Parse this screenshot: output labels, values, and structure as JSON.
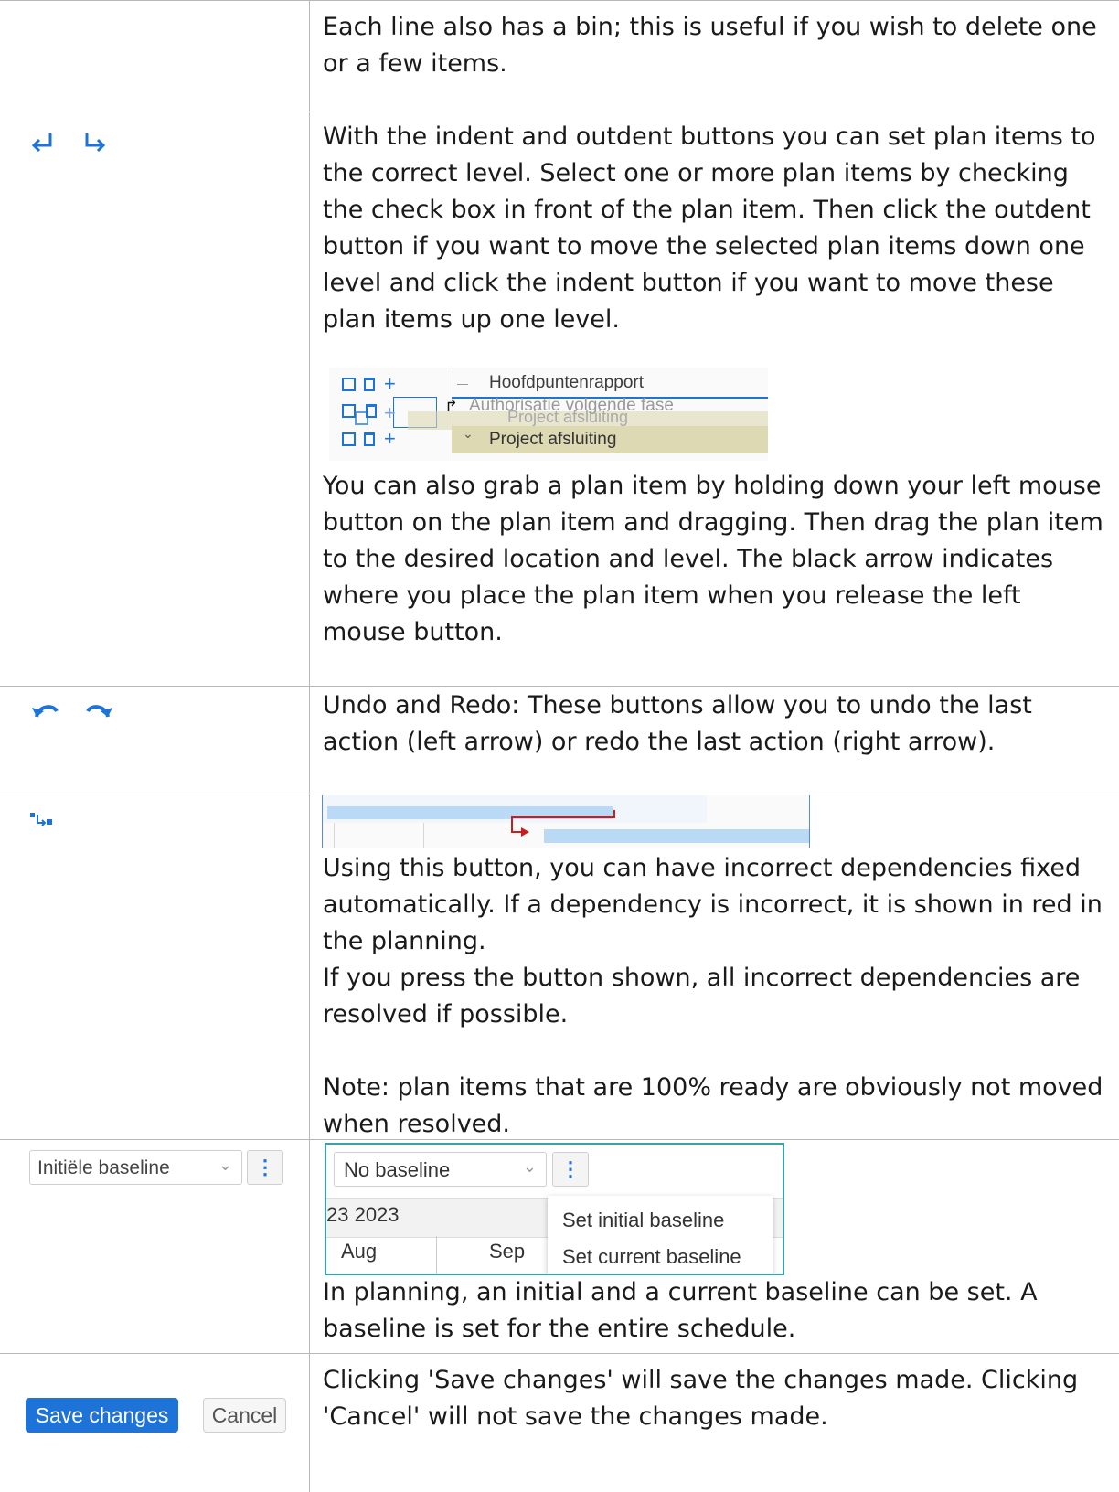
{
  "rows": [
    {
      "text": "Each line also has a bin; this is useful if you wish to delete one or a few items."
    },
    {
      "icons": [
        "indent-icon",
        "outdent-icon"
      ],
      "text": "With the indent and outdent buttons you can set plan items to the correct level. Select one or more plan items by checking the check box in front of the plan item. Then click the outdent button if you want to move the selected plan items down one level and click the indent button if you want to move these plan items up one level.",
      "drag_demo": {
        "item1": "Hoofdpuntenrapport",
        "item2": "Authorisatie volgende fase",
        "item2_ghost": "Project afsluiting",
        "item3": "Project afsluiting"
      },
      "text2": "You can also grab a plan item by holding down your left mouse button on the plan item and dragging. Then drag the plan item to the desired location and level. The black arrow indicates where you place the plan item when you release the left mouse button."
    },
    {
      "icons": [
        "undo-icon",
        "redo-icon"
      ],
      "text": "Undo and Redo: These buttons allow you to undo the last action (left arrow) or redo the last action (right arrow)."
    },
    {
      "icons": [
        "fix-dependencies-icon"
      ],
      "text_lines": [
        "Using this button, you can have incorrect dependencies fixed automatically. If a dependency is incorrect, it is shown in red in the planning.",
        "If you press the button shown, all incorrect dependencies are resolved if possible.",
        "",
        "Note: plan items that are 100% ready are obviously not moved when resolved."
      ]
    },
    {
      "baseline_select": "Initiële baseline",
      "demo": {
        "select": "No baseline",
        "quarter": "23 2023",
        "month1": "Aug",
        "month2": "Sep",
        "menu": [
          "Set initial baseline",
          "Set current baseline"
        ]
      },
      "text": "In planning, an initial and a current baseline can be set. A baseline is set for the entire schedule."
    },
    {
      "save_label": "Save changes",
      "cancel_label": "Cancel",
      "text": "Clicking 'Save changes' will save the changes made. Clicking 'Cancel' will not save the changes made."
    }
  ],
  "colors": {
    "accent": "#1e73d8",
    "highlight": "#dcd9b3",
    "error": "#c81e1e",
    "bar": "#b9d9f5"
  }
}
